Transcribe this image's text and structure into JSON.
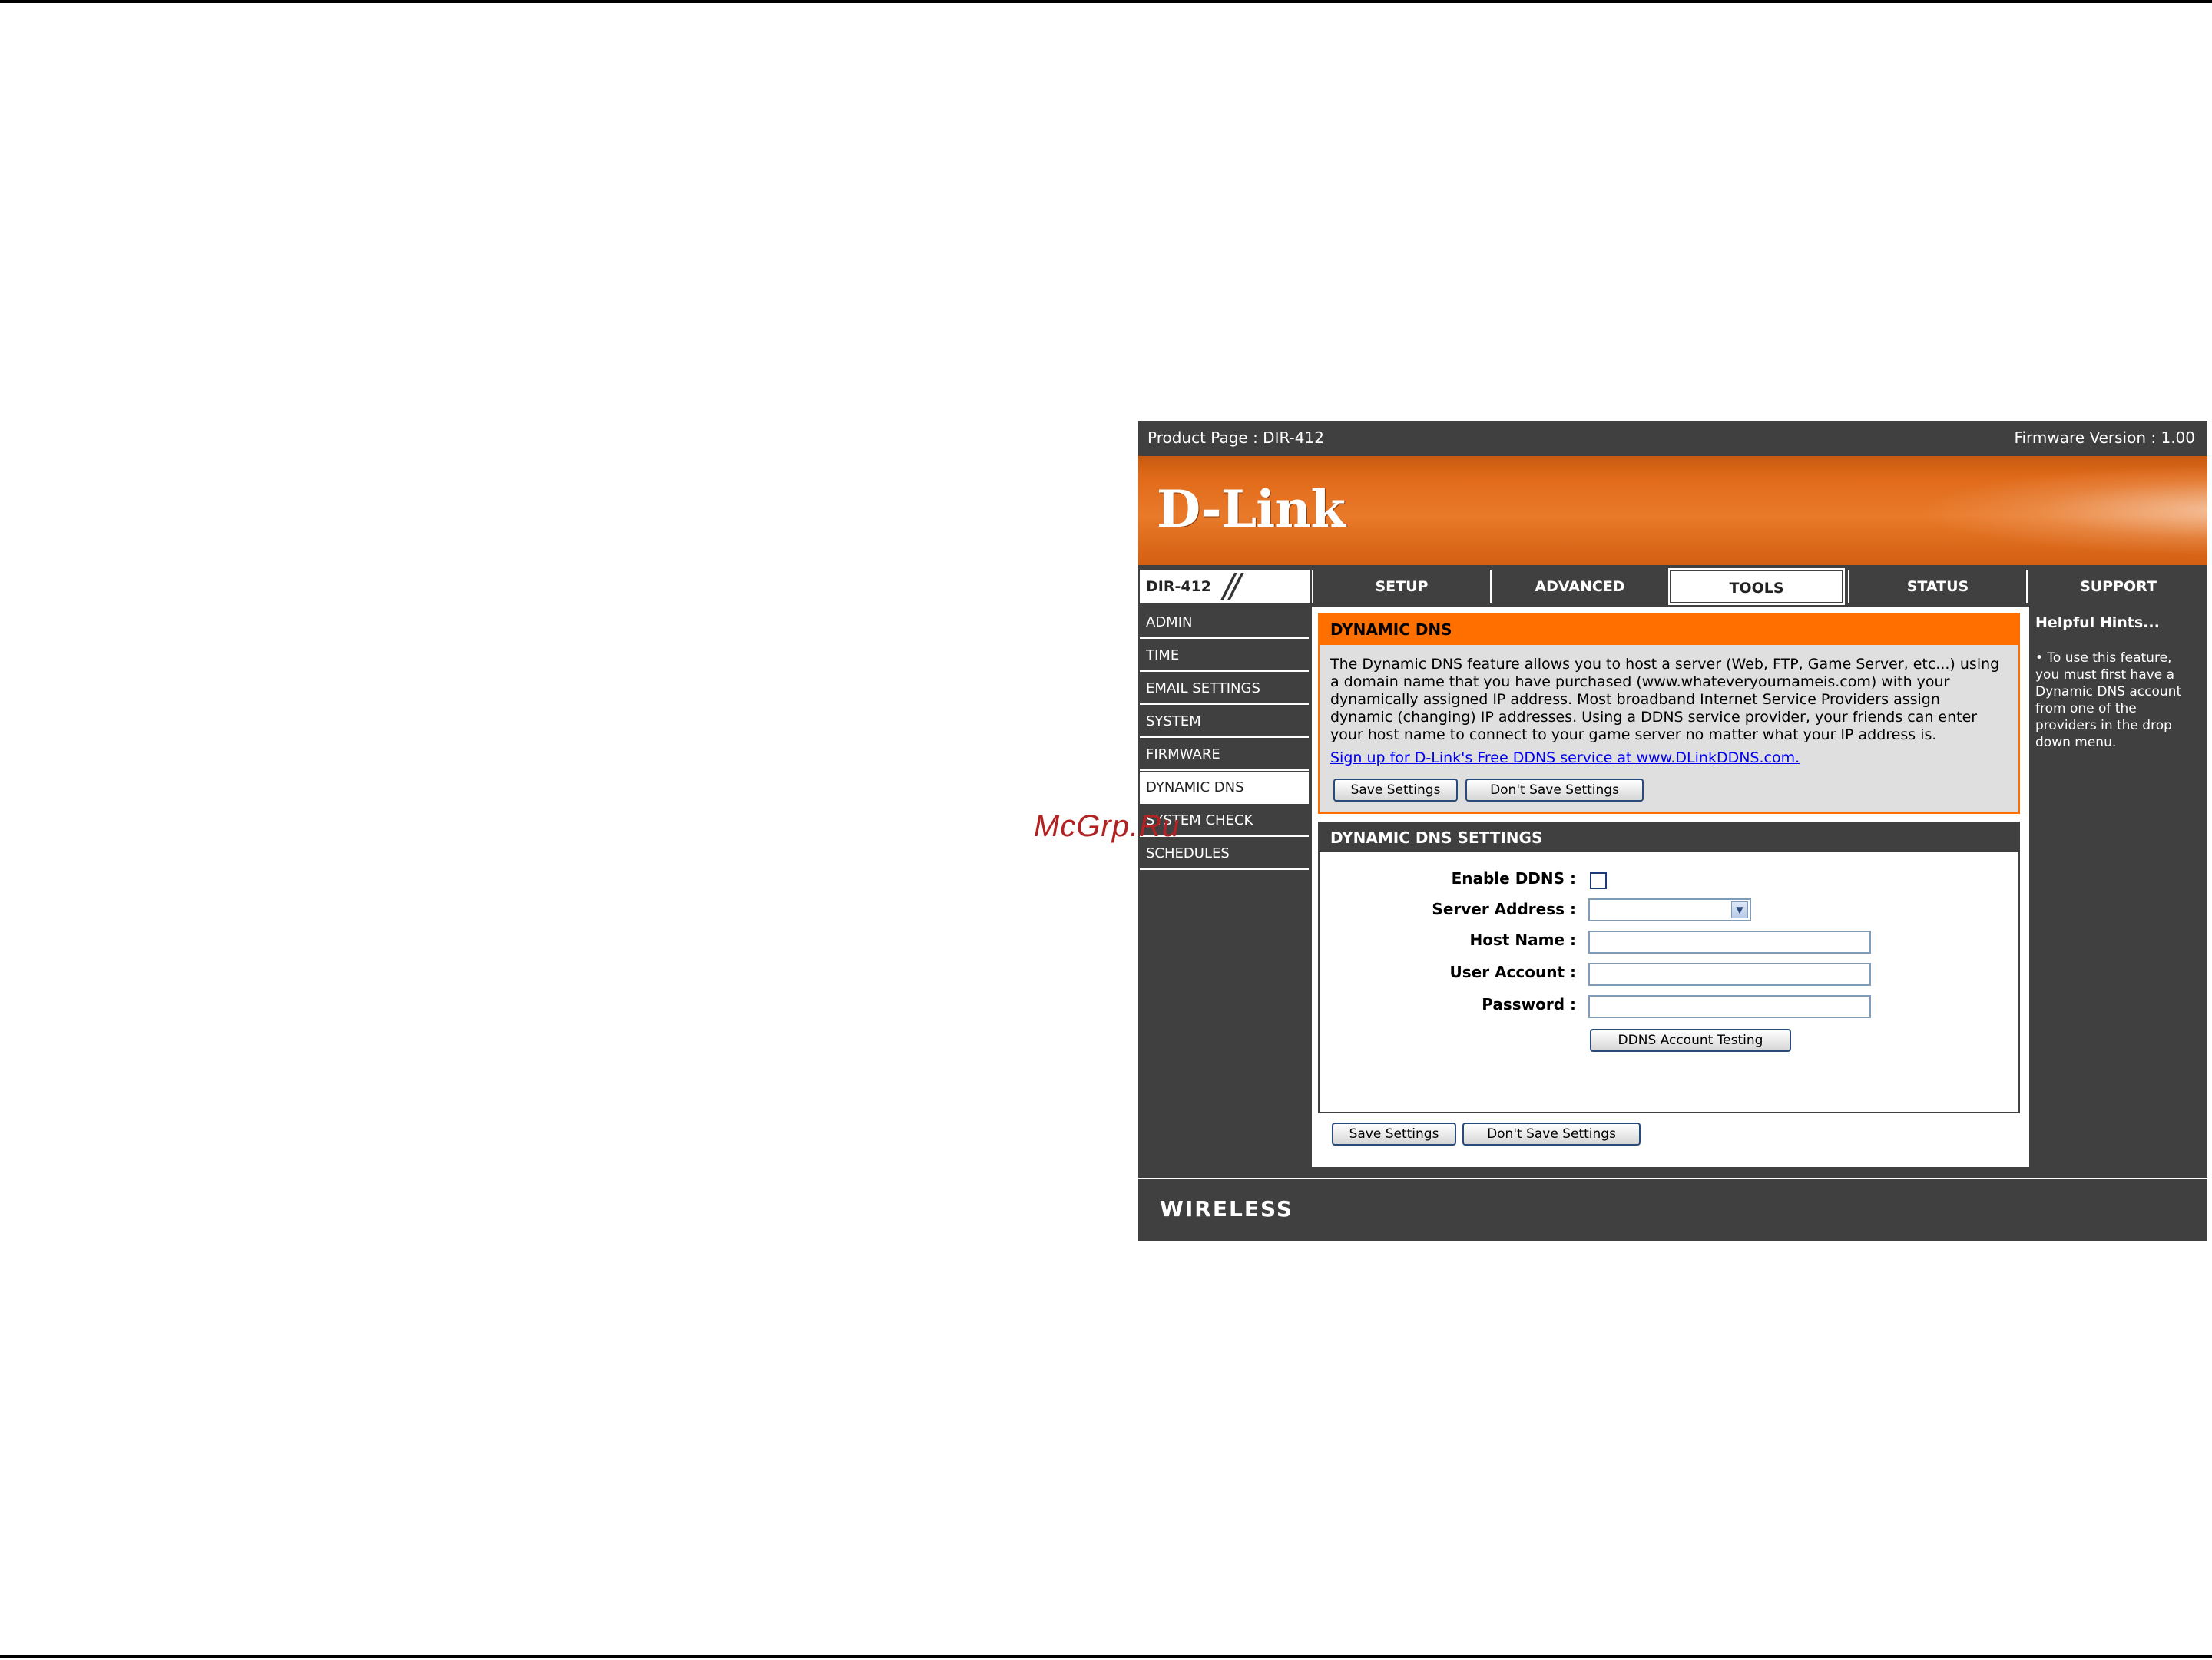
{
  "topbar": {
    "product": "Product Page : DIR-412",
    "firmware": "Firmware Version : 1.00"
  },
  "banner": {
    "logo": "D-Link"
  },
  "nav": {
    "model": "DIR-412",
    "tabs": [
      {
        "label": "SETUP"
      },
      {
        "label": "ADVANCED"
      },
      {
        "label": "TOOLS"
      },
      {
        "label": "STATUS"
      },
      {
        "label": "SUPPORT"
      }
    ],
    "active_tab": "TOOLS"
  },
  "sidebar": {
    "items": [
      {
        "label": "ADMIN"
      },
      {
        "label": "TIME"
      },
      {
        "label": "EMAIL SETTINGS"
      },
      {
        "label": "SYSTEM"
      },
      {
        "label": "FIRMWARE"
      },
      {
        "label": "DYNAMIC DNS"
      },
      {
        "label": "SYSTEM CHECK"
      },
      {
        "label": "SCHEDULES"
      }
    ],
    "active": "DYNAMIC DNS"
  },
  "intro": {
    "title": "DYNAMIC DNS",
    "description": "The Dynamic DNS feature allows you to host a server (Web, FTP, Game Server, etc...) using a domain name that you have purchased (www.whateveryournameis.com) with your dynamically assigned IP address. Most broadband Internet Service Providers assign dynamic (changing) IP addresses. Using a DDNS service provider, your friends can enter your host name to connect to your game server no matter what your IP address is.",
    "signup_link": "Sign up for D-Link's Free DDNS service at www.DLinkDDNS.com.",
    "save_label": "Save Settings",
    "dont_save_label": "Don't Save Settings"
  },
  "settings": {
    "title": "DYNAMIC DNS SETTINGS",
    "enable_label": "Enable DDNS :",
    "enable_checked": false,
    "server_label": "Server Address :",
    "server_value": "",
    "host_label": "Host Name :",
    "host_value": "",
    "account_label": "User Account :",
    "account_value": "",
    "password_label": "Password :",
    "password_value": "",
    "test_label": "DDNS Account Testing"
  },
  "bottom_buttons": {
    "save_label": "Save Settings",
    "dont_save_label": "Don't Save Settings"
  },
  "hints": {
    "title": "Helpful Hints...",
    "text": "• To use this feature, you must first have a Dynamic DNS account from one of the providers in the drop down menu."
  },
  "footer": {
    "brand": "WIRELESS"
  },
  "watermark": "McGrp.Ru",
  "colors": {
    "orange": "#ff6f00",
    "dark_gray": "#404040",
    "link": "#0000ee"
  }
}
